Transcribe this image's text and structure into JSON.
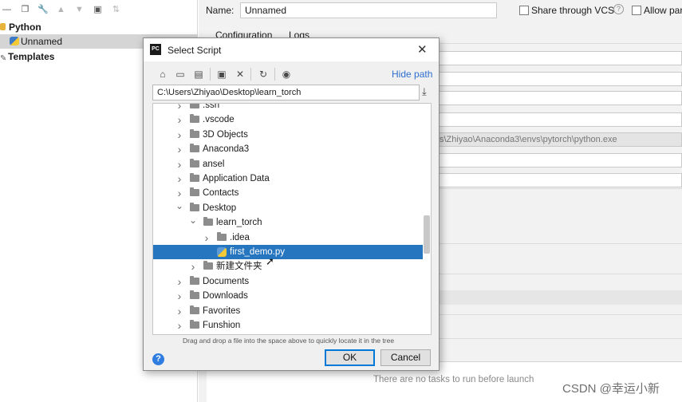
{
  "left_panel": {
    "tree": [
      {
        "label": "Python",
        "bold": true
      },
      {
        "label": "Unnamed",
        "selected": true
      },
      {
        "label": "Templates",
        "bold": true
      }
    ]
  },
  "config": {
    "name_label": "Name:",
    "name_value": "Unnamed",
    "share_vcs_label": "Share through VCS",
    "allow_parallel_label": "Allow par",
    "tabs": [
      "Configuration",
      "Logs"
    ],
    "interpreter_path": "s\\Zhiyao\\Anaconda3\\envs\\pytorch\\python.exe",
    "no_tasks_text": "There are no tasks to run before launch"
  },
  "dialog": {
    "title": "Select Script",
    "icon_text": "PC",
    "hide_path_label": "Hide path",
    "path_value": "C:\\Users\\Zhiyao\\Desktop\\learn_torch",
    "tree": [
      {
        "label": ".ssh",
        "level": 0,
        "chevron": "right"
      },
      {
        "label": ".vscode",
        "level": 0,
        "chevron": "right"
      },
      {
        "label": "3D Objects",
        "level": 0,
        "chevron": "right"
      },
      {
        "label": "Anaconda3",
        "level": 0,
        "chevron": "right"
      },
      {
        "label": "ansel",
        "level": 0,
        "chevron": "right"
      },
      {
        "label": "Application Data",
        "level": 0,
        "chevron": "right"
      },
      {
        "label": "Contacts",
        "level": 0,
        "chevron": "right"
      },
      {
        "label": "Desktop",
        "level": 0,
        "chevron": "down"
      },
      {
        "label": "learn_torch",
        "level": 1,
        "chevron": "down"
      },
      {
        "label": ".idea",
        "level": 2,
        "chevron": "right"
      },
      {
        "label": "first_demo.py",
        "level": 2,
        "chevron": "none",
        "selected": true,
        "file": true
      },
      {
        "label": "新建文件夹",
        "level": 1,
        "chevron": "right"
      },
      {
        "label": "Documents",
        "level": 0,
        "chevron": "right"
      },
      {
        "label": "Downloads",
        "level": 0,
        "chevron": "right"
      },
      {
        "label": "Favorites",
        "level": 0,
        "chevron": "right"
      },
      {
        "label": "Funshion",
        "level": 0,
        "chevron": "right"
      }
    ],
    "hint": "Drag and drop a file into the space above to quickly locate it in the tree",
    "help_label": "?",
    "ok_label": "OK",
    "cancel_label": "Cancel"
  },
  "watermark": "CSDN @幸运小新",
  "colors": {
    "selection": "#2675bf",
    "link": "#2f6fd0",
    "help": "#2f7de1"
  }
}
